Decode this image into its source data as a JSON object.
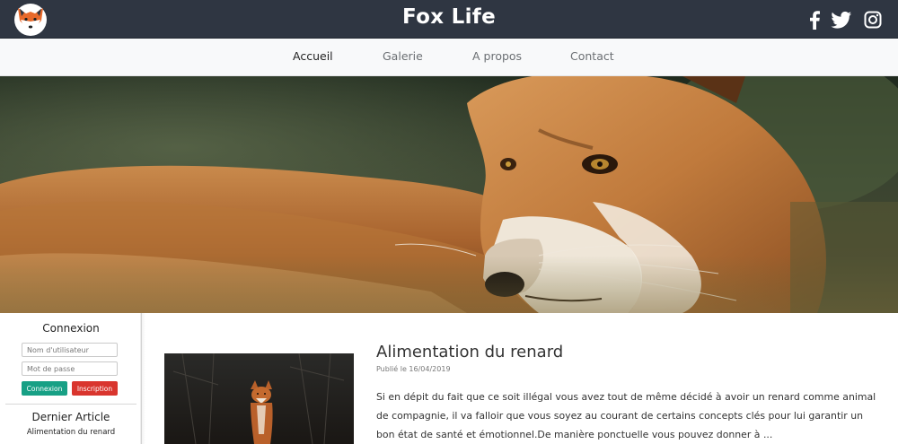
{
  "header": {
    "title": "Fox Life",
    "logo_icon": "fox-logo-icon",
    "social": [
      "facebook-icon",
      "twitter-icon",
      "instagram-icon"
    ],
    "background_color": "#2f3642"
  },
  "nav": {
    "items": [
      {
        "label": "Accueil",
        "active": true
      },
      {
        "label": "Galerie",
        "active": false
      },
      {
        "label": "A propos",
        "active": false
      },
      {
        "label": "Contact",
        "active": false
      }
    ]
  },
  "hero": {
    "image": "red-fox-close-up-photo"
  },
  "sidebar": {
    "login": {
      "heading": "Connexion",
      "username_placeholder": "Nom d'utilisateur",
      "password_placeholder": "Mot de passe",
      "login_button": "Connexion",
      "signup_button": "Inscription"
    },
    "latest": {
      "heading": "Dernier Article",
      "link": "Alimentation du renard"
    }
  },
  "article": {
    "title": "Alimentation du renard",
    "date": "Publié le 16/04/2019",
    "excerpt": "Si en dépit du fait que ce soit illégal vous avez tout de même décidé à avoir un renard comme animal de compagnie, il va falloir que vous soyez au courant de certains concepts clés pour lui garantir un bon état de santé et émotionnel.De manière ponctuelle vous pouvez donner à ...",
    "thumbnail": "fox-in-forest-photo"
  },
  "colors": {
    "topbar": "#2f3642",
    "nav_bg": "#f8f9fa",
    "login_button": "#17a085",
    "signup_button": "#d9352e"
  }
}
